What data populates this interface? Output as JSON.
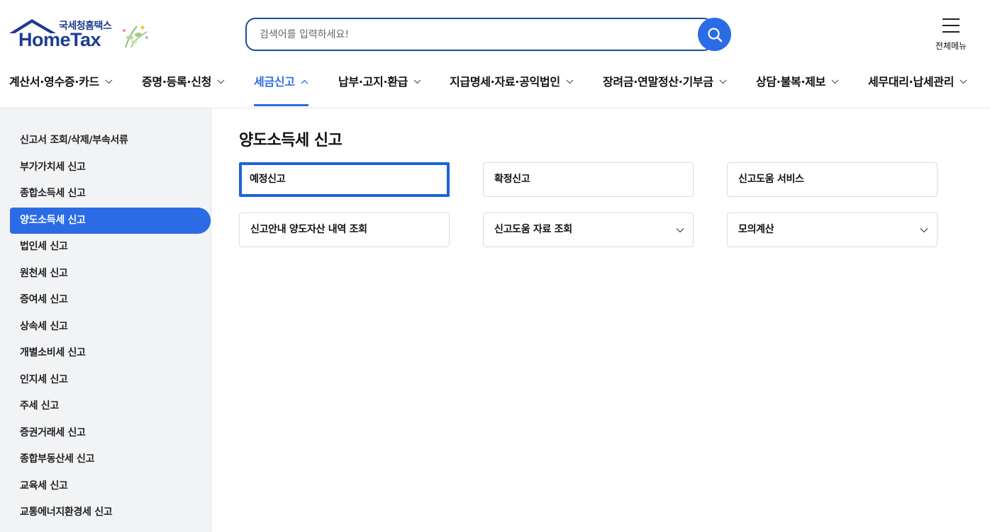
{
  "logo": {
    "korean": "국세청홈택스",
    "english": "HomeTax"
  },
  "search": {
    "placeholder": "검색어를 입력하세요!",
    "value": ""
  },
  "header": {
    "all_menu_label": "전체메뉴"
  },
  "gnb": [
    {
      "label": "계산서·영수증·카드",
      "active": false
    },
    {
      "label": "증명·등록·신청",
      "active": false
    },
    {
      "label": "세금신고",
      "active": true
    },
    {
      "label": "납부·고지·환급",
      "active": false
    },
    {
      "label": "지급명세·자료·공익법인",
      "active": false
    },
    {
      "label": "장려금·연말정산·기부금",
      "active": false
    },
    {
      "label": "상담·불복·제보",
      "active": false
    },
    {
      "label": "세무대리·납세관리",
      "active": false
    }
  ],
  "sidebar": {
    "items": [
      {
        "label": "신고서 조회/삭제/부속서류"
      },
      {
        "label": "부가가치세 신고"
      },
      {
        "label": "종합소득세 신고"
      },
      {
        "label": "양도소득세 신고",
        "active": true
      },
      {
        "label": "법인세 신고"
      },
      {
        "label": "원천세 신고"
      },
      {
        "label": "증여세 신고"
      },
      {
        "label": "상속세 신고"
      },
      {
        "label": "개별소비세 신고"
      },
      {
        "label": "인지세 신고"
      },
      {
        "label": "주세 신고"
      },
      {
        "label": "증권거래세 신고"
      },
      {
        "label": "종합부동산세 신고"
      },
      {
        "label": "교육세 신고"
      },
      {
        "label": "교통에너지환경세 신고"
      }
    ]
  },
  "main": {
    "title": "양도소득세 신고",
    "cards": [
      {
        "label": "예정신고",
        "selected": true,
        "dropdown": false
      },
      {
        "label": "확정신고",
        "selected": false,
        "dropdown": false
      },
      {
        "label": "신고도움 서비스",
        "selected": false,
        "dropdown": false
      },
      {
        "label": "신고안내 양도자산 내역 조회",
        "selected": false,
        "dropdown": false
      },
      {
        "label": "신고도움 자료 조회",
        "selected": false,
        "dropdown": true
      },
      {
        "label": "모의계산",
        "selected": false,
        "dropdown": true
      }
    ]
  },
  "colors": {
    "accent": "#2b6ce6",
    "brand_navy": "#1d3d8f",
    "sidebar_bg": "#f2f3f5"
  }
}
